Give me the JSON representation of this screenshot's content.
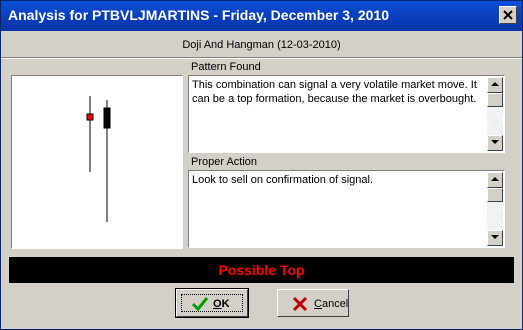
{
  "window": {
    "title": "Analysis for PTBVLJMARTINS - Friday, December 3, 2010",
    "close_label": "close"
  },
  "pattern": {
    "subtitle": "Doji And Hangman (12-03-2010)"
  },
  "pattern_found": {
    "label": "Pattern Found",
    "text": "This combination can signal a very volatile market move. It can be a top formation, because the market is overbought."
  },
  "proper_action": {
    "label": "Proper Action",
    "text": "Look to sell on confirmation of signal."
  },
  "status": {
    "text": "Possible Top",
    "color": "#ff0000",
    "background": "#000000"
  },
  "buttons": {
    "ok_label": "OK",
    "ok_underline": "O",
    "ok_rest": "K",
    "cancel_underline": "C",
    "cancel_rest": "ancel"
  },
  "candles": [
    {
      "name": "doji",
      "color": "#ff0000"
    },
    {
      "name": "hangman",
      "color": "#000000"
    }
  ]
}
